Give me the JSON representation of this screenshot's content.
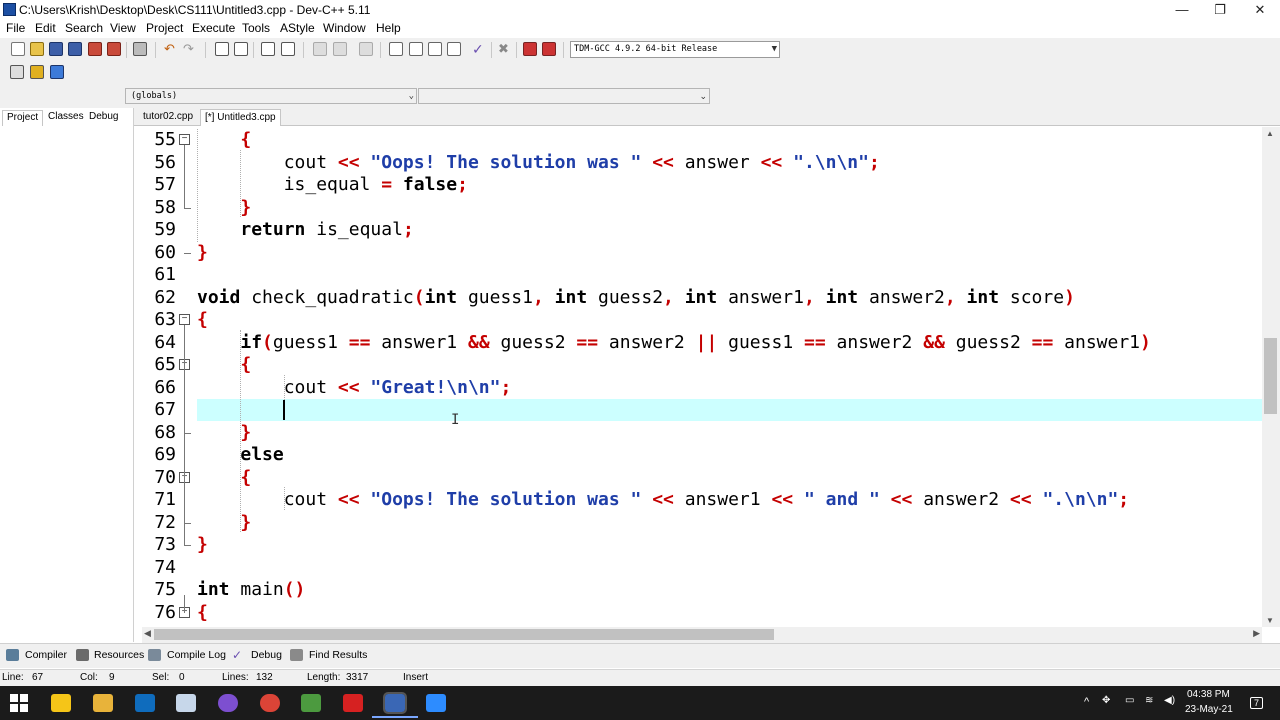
{
  "window": {
    "title": "C:\\Users\\Krish\\Desktop\\Desk\\CS111\\Untitled3.cpp - Dev-C++ 5.11",
    "controls": [
      "—",
      "❐",
      "✕"
    ]
  },
  "menu": [
    "File",
    "Edit",
    "Search",
    "View",
    "Project",
    "Execute",
    "Tools",
    "AStyle",
    "Window",
    "Help"
  ],
  "compiler": {
    "selected": "TDM-GCC 4.9.2 64-bit Release"
  },
  "scope": {
    "globals": "(globals)",
    "member": ""
  },
  "left_tabs": [
    "Project",
    "Classes",
    "Debug"
  ],
  "file_tabs": [
    "tutor02.cpp",
    "[*] Untitled3.cpp"
  ],
  "editor": {
    "lines": [
      {
        "n": "55",
        "fold": "open",
        "tokens": [
          {
            "t": "    ",
            "c": "plain"
          },
          {
            "t": "{",
            "c": "sym"
          }
        ]
      },
      {
        "n": "56",
        "fold": "",
        "tokens": [
          {
            "t": "        cout ",
            "c": "plain"
          },
          {
            "t": "<<",
            "c": "sym"
          },
          {
            "t": " ",
            "c": "plain"
          },
          {
            "t": "\"Oops! The solution was \"",
            "c": "str"
          },
          {
            "t": " ",
            "c": "plain"
          },
          {
            "t": "<<",
            "c": "sym"
          },
          {
            "t": " answer ",
            "c": "plain"
          },
          {
            "t": "<<",
            "c": "sym"
          },
          {
            "t": " ",
            "c": "plain"
          },
          {
            "t": "\".\\n\\n\"",
            "c": "str"
          },
          {
            "t": ";",
            "c": "sym"
          }
        ]
      },
      {
        "n": "57",
        "fold": "",
        "tokens": [
          {
            "t": "        is_equal ",
            "c": "plain"
          },
          {
            "t": "=",
            "c": "sym"
          },
          {
            "t": " ",
            "c": "plain"
          },
          {
            "t": "false",
            "c": "kw"
          },
          {
            "t": ";",
            "c": "sym"
          }
        ]
      },
      {
        "n": "58",
        "fold": "end",
        "tokens": [
          {
            "t": "    ",
            "c": "plain"
          },
          {
            "t": "}",
            "c": "sym"
          }
        ]
      },
      {
        "n": "59",
        "fold": "",
        "tokens": [
          {
            "t": "    ",
            "c": "plain"
          },
          {
            "t": "return",
            "c": "kw"
          },
          {
            "t": " is_equal",
            "c": "plain"
          },
          {
            "t": ";",
            "c": "sym"
          }
        ]
      },
      {
        "n": "60",
        "fold": "end",
        "tokens": [
          {
            "t": "}",
            "c": "sym"
          }
        ]
      },
      {
        "n": "61",
        "fold": "",
        "tokens": []
      },
      {
        "n": "62",
        "fold": "",
        "tokens": [
          {
            "t": "void",
            "c": "kw"
          },
          {
            "t": " check_quadratic",
            "c": "plain"
          },
          {
            "t": "(",
            "c": "sym"
          },
          {
            "t": "int",
            "c": "kw"
          },
          {
            "t": " guess1",
            "c": "plain"
          },
          {
            "t": ",",
            "c": "sym"
          },
          {
            "t": " ",
            "c": "plain"
          },
          {
            "t": "int",
            "c": "kw"
          },
          {
            "t": " guess2",
            "c": "plain"
          },
          {
            "t": ",",
            "c": "sym"
          },
          {
            "t": " ",
            "c": "plain"
          },
          {
            "t": "int",
            "c": "kw"
          },
          {
            "t": " answer1",
            "c": "plain"
          },
          {
            "t": ",",
            "c": "sym"
          },
          {
            "t": " ",
            "c": "plain"
          },
          {
            "t": "int",
            "c": "kw"
          },
          {
            "t": " answer2",
            "c": "plain"
          },
          {
            "t": ",",
            "c": "sym"
          },
          {
            "t": " ",
            "c": "plain"
          },
          {
            "t": "int",
            "c": "kw"
          },
          {
            "t": " score",
            "c": "plain"
          },
          {
            "t": ")",
            "c": "sym"
          }
        ]
      },
      {
        "n": "63",
        "fold": "open",
        "tokens": [
          {
            "t": "{",
            "c": "sym"
          }
        ]
      },
      {
        "n": "64",
        "fold": "",
        "tokens": [
          {
            "t": "    ",
            "c": "plain"
          },
          {
            "t": "if",
            "c": "kw"
          },
          {
            "t": "(",
            "c": "sym"
          },
          {
            "t": "guess1 ",
            "c": "plain"
          },
          {
            "t": "==",
            "c": "sym"
          },
          {
            "t": " answer1 ",
            "c": "plain"
          },
          {
            "t": "&&",
            "c": "sym"
          },
          {
            "t": " guess2 ",
            "c": "plain"
          },
          {
            "t": "==",
            "c": "sym"
          },
          {
            "t": " answer2 ",
            "c": "plain"
          },
          {
            "t": "||",
            "c": "sym"
          },
          {
            "t": " guess1 ",
            "c": "plain"
          },
          {
            "t": "==",
            "c": "sym"
          },
          {
            "t": " answer2 ",
            "c": "plain"
          },
          {
            "t": "&&",
            "c": "sym"
          },
          {
            "t": " guess2 ",
            "c": "plain"
          },
          {
            "t": "==",
            "c": "sym"
          },
          {
            "t": " answer1",
            "c": "plain"
          },
          {
            "t": ")",
            "c": "sym"
          }
        ]
      },
      {
        "n": "65",
        "fold": "open",
        "tokens": [
          {
            "t": "    ",
            "c": "plain"
          },
          {
            "t": "{",
            "c": "sym"
          }
        ]
      },
      {
        "n": "66",
        "fold": "",
        "tokens": [
          {
            "t": "        cout ",
            "c": "plain"
          },
          {
            "t": "<<",
            "c": "sym"
          },
          {
            "t": " ",
            "c": "plain"
          },
          {
            "t": "\"Great!\\n\\n\"",
            "c": "str"
          },
          {
            "t": ";",
            "c": "sym"
          }
        ]
      },
      {
        "n": "67",
        "fold": "",
        "tokens": []
      },
      {
        "n": "68",
        "fold": "end",
        "tokens": [
          {
            "t": "    ",
            "c": "plain"
          },
          {
            "t": "}",
            "c": "sym"
          }
        ]
      },
      {
        "n": "69",
        "fold": "",
        "tokens": [
          {
            "t": "    ",
            "c": "plain"
          },
          {
            "t": "else",
            "c": "kw"
          }
        ]
      },
      {
        "n": "70",
        "fold": "open",
        "tokens": [
          {
            "t": "    ",
            "c": "plain"
          },
          {
            "t": "{",
            "c": "sym"
          }
        ]
      },
      {
        "n": "71",
        "fold": "",
        "tokens": [
          {
            "t": "        cout ",
            "c": "plain"
          },
          {
            "t": "<<",
            "c": "sym"
          },
          {
            "t": " ",
            "c": "plain"
          },
          {
            "t": "\"Oops! The solution was \"",
            "c": "str"
          },
          {
            "t": " ",
            "c": "plain"
          },
          {
            "t": "<<",
            "c": "sym"
          },
          {
            "t": " answer1 ",
            "c": "plain"
          },
          {
            "t": "<<",
            "c": "sym"
          },
          {
            "t": " ",
            "c": "plain"
          },
          {
            "t": "\" and \"",
            "c": "str"
          },
          {
            "t": " ",
            "c": "plain"
          },
          {
            "t": "<<",
            "c": "sym"
          },
          {
            "t": " answer2 ",
            "c": "plain"
          },
          {
            "t": "<<",
            "c": "sym"
          },
          {
            "t": " ",
            "c": "plain"
          },
          {
            "t": "\".\\n\\n\"",
            "c": "str"
          },
          {
            "t": ";",
            "c": "sym"
          }
        ]
      },
      {
        "n": "72",
        "fold": "end",
        "tokens": [
          {
            "t": "    ",
            "c": "plain"
          },
          {
            "t": "}",
            "c": "sym"
          }
        ]
      },
      {
        "n": "73",
        "fold": "end",
        "tokens": [
          {
            "t": "}",
            "c": "sym"
          }
        ]
      },
      {
        "n": "74",
        "fold": "",
        "tokens": []
      },
      {
        "n": "75",
        "fold": "",
        "tokens": [
          {
            "t": "int",
            "c": "kw"
          },
          {
            "t": " main",
            "c": "plain"
          },
          {
            "t": "()",
            "c": "sym"
          }
        ]
      },
      {
        "n": "76",
        "fold": "open",
        "tokens": [
          {
            "t": "{",
            "c": "sym"
          }
        ]
      }
    ],
    "current_line": "67"
  },
  "bottom_tabs": [
    {
      "label": "Compiler",
      "icon": "compiler-icon"
    },
    {
      "label": "Resources",
      "icon": "resources-icon"
    },
    {
      "label": "Compile Log",
      "icon": "compile-log-icon"
    },
    {
      "label": "Debug",
      "icon": "debug-icon"
    },
    {
      "label": "Find Results",
      "icon": "find-results-icon"
    }
  ],
  "status": {
    "line_label": "Line:",
    "line": "67",
    "col_label": "Col:",
    "col": "9",
    "sel_label": "Sel:",
    "sel": "0",
    "lines_label": "Lines:",
    "lines": "132",
    "length_label": "Length:",
    "length": "3317",
    "mode": "Insert"
  },
  "taskbar": {
    "time": "04:38 PM",
    "date": "23-May-21",
    "notifications": "7"
  },
  "colors": {
    "symbol": "#c40000",
    "string": "#1f3ea8",
    "current_line": "#ccffff"
  }
}
